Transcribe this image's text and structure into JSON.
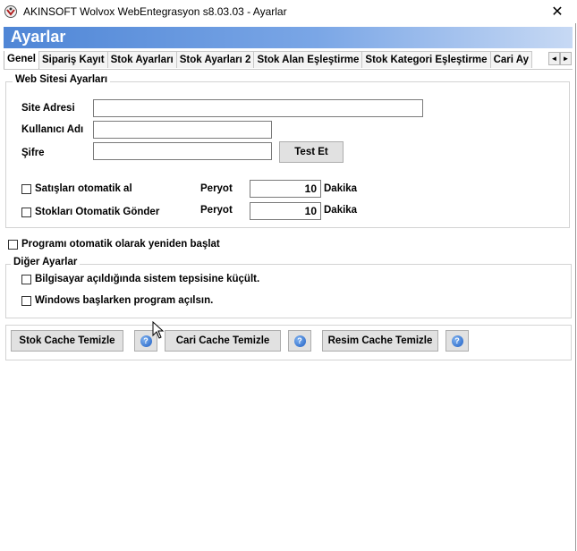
{
  "window": {
    "title": "AKINSOFT Wolvox WebEntegrasyon s8.03.03 - Ayarlar",
    "close_glyph": "✕"
  },
  "header": {
    "title": "Ayarlar"
  },
  "tabs": [
    {
      "label": "Genel",
      "active": true
    },
    {
      "label": "Sipariş Kayıt"
    },
    {
      "label": "Stok Ayarları"
    },
    {
      "label": "Stok Ayarları 2"
    },
    {
      "label": "Stok Alan Eşleştirme"
    },
    {
      "label": "Stok Kategori Eşleştirme"
    },
    {
      "label": "Cari Ay"
    }
  ],
  "tab_scroll": {
    "left": "◄",
    "right": "►"
  },
  "web_settings": {
    "legend": "Web Sitesi Ayarları",
    "site_label": "Site Adresi",
    "site_value": "",
    "user_label": "Kullanıcı Adı",
    "user_value": "",
    "password_label": "Şifre",
    "password_value": "",
    "test_button": "Test Et",
    "sales_auto_label": "Satışları otomatik al",
    "sales_period_label": "Peryot",
    "sales_period_value": "10",
    "sales_unit": "Dakika",
    "stock_auto_label": "Stokları Otomatik Gönder",
    "stock_period_label": "Peryot",
    "stock_period_value": "10",
    "stock_unit": "Dakika"
  },
  "restart_label": "Programı otomatik olarak yeniden başlat",
  "other_settings": {
    "legend": "Diğer Ayarlar",
    "tray_label": "Bilgisayar açıldığında sistem tepsisine küçült.",
    "startup_label": "Windows başlarken program açılsın."
  },
  "cache": {
    "stock_button": "Stok Cache Temizle",
    "cari_button": "Cari Cache Temizle",
    "image_button": "Resim Cache Temizle",
    "help_glyph": "?"
  },
  "colors": {
    "header_start": "#4f86d6",
    "header_end": "#c7d9f4",
    "button_face": "#e1e1e1"
  }
}
